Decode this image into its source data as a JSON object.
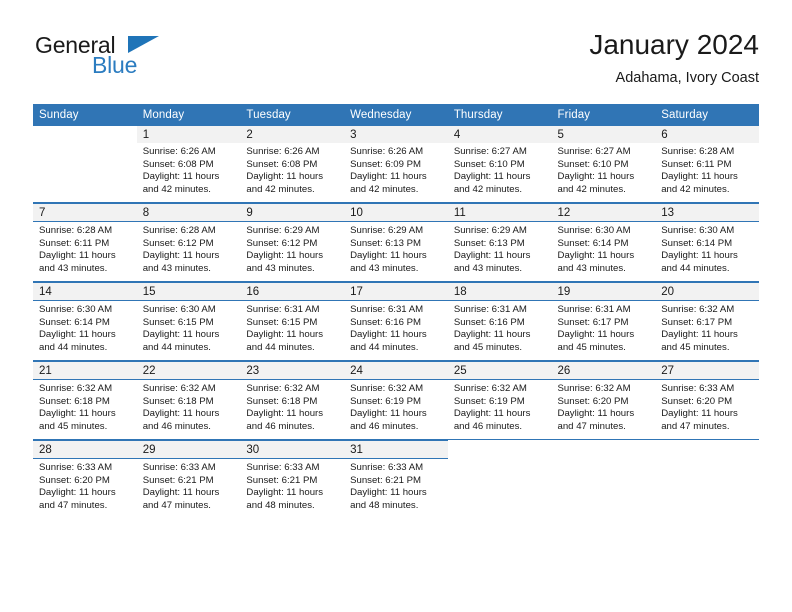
{
  "brand": {
    "name_primary": "General",
    "name_secondary": "Blue",
    "triangle_icon": "triangle-logo-icon"
  },
  "header": {
    "title": "January 2024",
    "subtitle": "Adahama, Ivory Coast"
  },
  "colors": {
    "header_blue": "#3075b5",
    "brand_blue": "#2b7cc0",
    "daynum_band": "#f2f2f2",
    "text": "#1a1a1a"
  },
  "weekday_headers": [
    "Sunday",
    "Monday",
    "Tuesday",
    "Wednesday",
    "Thursday",
    "Friday",
    "Saturday"
  ],
  "weeks": [
    [
      {
        "day": "",
        "sunrise": "",
        "sunset": "",
        "daylight": "",
        "empty": true
      },
      {
        "day": "1",
        "sunrise": "Sunrise: 6:26 AM",
        "sunset": "Sunset: 6:08 PM",
        "daylight": "Daylight: 11 hours and 42 minutes."
      },
      {
        "day": "2",
        "sunrise": "Sunrise: 6:26 AM",
        "sunset": "Sunset: 6:08 PM",
        "daylight": "Daylight: 11 hours and 42 minutes."
      },
      {
        "day": "3",
        "sunrise": "Sunrise: 6:26 AM",
        "sunset": "Sunset: 6:09 PM",
        "daylight": "Daylight: 11 hours and 42 minutes."
      },
      {
        "day": "4",
        "sunrise": "Sunrise: 6:27 AM",
        "sunset": "Sunset: 6:10 PM",
        "daylight": "Daylight: 11 hours and 42 minutes."
      },
      {
        "day": "5",
        "sunrise": "Sunrise: 6:27 AM",
        "sunset": "Sunset: 6:10 PM",
        "daylight": "Daylight: 11 hours and 42 minutes."
      },
      {
        "day": "6",
        "sunrise": "Sunrise: 6:28 AM",
        "sunset": "Sunset: 6:11 PM",
        "daylight": "Daylight: 11 hours and 42 minutes."
      }
    ],
    [
      {
        "day": "7",
        "sunrise": "Sunrise: 6:28 AM",
        "sunset": "Sunset: 6:11 PM",
        "daylight": "Daylight: 11 hours and 43 minutes."
      },
      {
        "day": "8",
        "sunrise": "Sunrise: 6:28 AM",
        "sunset": "Sunset: 6:12 PM",
        "daylight": "Daylight: 11 hours and 43 minutes."
      },
      {
        "day": "9",
        "sunrise": "Sunrise: 6:29 AM",
        "sunset": "Sunset: 6:12 PM",
        "daylight": "Daylight: 11 hours and 43 minutes."
      },
      {
        "day": "10",
        "sunrise": "Sunrise: 6:29 AM",
        "sunset": "Sunset: 6:13 PM",
        "daylight": "Daylight: 11 hours and 43 minutes."
      },
      {
        "day": "11",
        "sunrise": "Sunrise: 6:29 AM",
        "sunset": "Sunset: 6:13 PM",
        "daylight": "Daylight: 11 hours and 43 minutes."
      },
      {
        "day": "12",
        "sunrise": "Sunrise: 6:30 AM",
        "sunset": "Sunset: 6:14 PM",
        "daylight": "Daylight: 11 hours and 43 minutes."
      },
      {
        "day": "13",
        "sunrise": "Sunrise: 6:30 AM",
        "sunset": "Sunset: 6:14 PM",
        "daylight": "Daylight: 11 hours and 44 minutes."
      }
    ],
    [
      {
        "day": "14",
        "sunrise": "Sunrise: 6:30 AM",
        "sunset": "Sunset: 6:14 PM",
        "daylight": "Daylight: 11 hours and 44 minutes."
      },
      {
        "day": "15",
        "sunrise": "Sunrise: 6:30 AM",
        "sunset": "Sunset: 6:15 PM",
        "daylight": "Daylight: 11 hours and 44 minutes."
      },
      {
        "day": "16",
        "sunrise": "Sunrise: 6:31 AM",
        "sunset": "Sunset: 6:15 PM",
        "daylight": "Daylight: 11 hours and 44 minutes."
      },
      {
        "day": "17",
        "sunrise": "Sunrise: 6:31 AM",
        "sunset": "Sunset: 6:16 PM",
        "daylight": "Daylight: 11 hours and 44 minutes."
      },
      {
        "day": "18",
        "sunrise": "Sunrise: 6:31 AM",
        "sunset": "Sunset: 6:16 PM",
        "daylight": "Daylight: 11 hours and 45 minutes."
      },
      {
        "day": "19",
        "sunrise": "Sunrise: 6:31 AM",
        "sunset": "Sunset: 6:17 PM",
        "daylight": "Daylight: 11 hours and 45 minutes."
      },
      {
        "day": "20",
        "sunrise": "Sunrise: 6:32 AM",
        "sunset": "Sunset: 6:17 PM",
        "daylight": "Daylight: 11 hours and 45 minutes."
      }
    ],
    [
      {
        "day": "21",
        "sunrise": "Sunrise: 6:32 AM",
        "sunset": "Sunset: 6:18 PM",
        "daylight": "Daylight: 11 hours and 45 minutes."
      },
      {
        "day": "22",
        "sunrise": "Sunrise: 6:32 AM",
        "sunset": "Sunset: 6:18 PM",
        "daylight": "Daylight: 11 hours and 46 minutes."
      },
      {
        "day": "23",
        "sunrise": "Sunrise: 6:32 AM",
        "sunset": "Sunset: 6:18 PM",
        "daylight": "Daylight: 11 hours and 46 minutes."
      },
      {
        "day": "24",
        "sunrise": "Sunrise: 6:32 AM",
        "sunset": "Sunset: 6:19 PM",
        "daylight": "Daylight: 11 hours and 46 minutes."
      },
      {
        "day": "25",
        "sunrise": "Sunrise: 6:32 AM",
        "sunset": "Sunset: 6:19 PM",
        "daylight": "Daylight: 11 hours and 46 minutes."
      },
      {
        "day": "26",
        "sunrise": "Sunrise: 6:32 AM",
        "sunset": "Sunset: 6:20 PM",
        "daylight": "Daylight: 11 hours and 47 minutes."
      },
      {
        "day": "27",
        "sunrise": "Sunrise: 6:33 AM",
        "sunset": "Sunset: 6:20 PM",
        "daylight": "Daylight: 11 hours and 47 minutes."
      }
    ],
    [
      {
        "day": "28",
        "sunrise": "Sunrise: 6:33 AM",
        "sunset": "Sunset: 6:20 PM",
        "daylight": "Daylight: 11 hours and 47 minutes."
      },
      {
        "day": "29",
        "sunrise": "Sunrise: 6:33 AM",
        "sunset": "Sunset: 6:21 PM",
        "daylight": "Daylight: 11 hours and 47 minutes."
      },
      {
        "day": "30",
        "sunrise": "Sunrise: 6:33 AM",
        "sunset": "Sunset: 6:21 PM",
        "daylight": "Daylight: 11 hours and 48 minutes."
      },
      {
        "day": "31",
        "sunrise": "Sunrise: 6:33 AM",
        "sunset": "Sunset: 6:21 PM",
        "daylight": "Daylight: 11 hours and 48 minutes."
      },
      {
        "day": "",
        "sunrise": "",
        "sunset": "",
        "daylight": "",
        "empty": true
      },
      {
        "day": "",
        "sunrise": "",
        "sunset": "",
        "daylight": "",
        "empty": true
      },
      {
        "day": "",
        "sunrise": "",
        "sunset": "",
        "daylight": "",
        "empty": true
      }
    ]
  ]
}
